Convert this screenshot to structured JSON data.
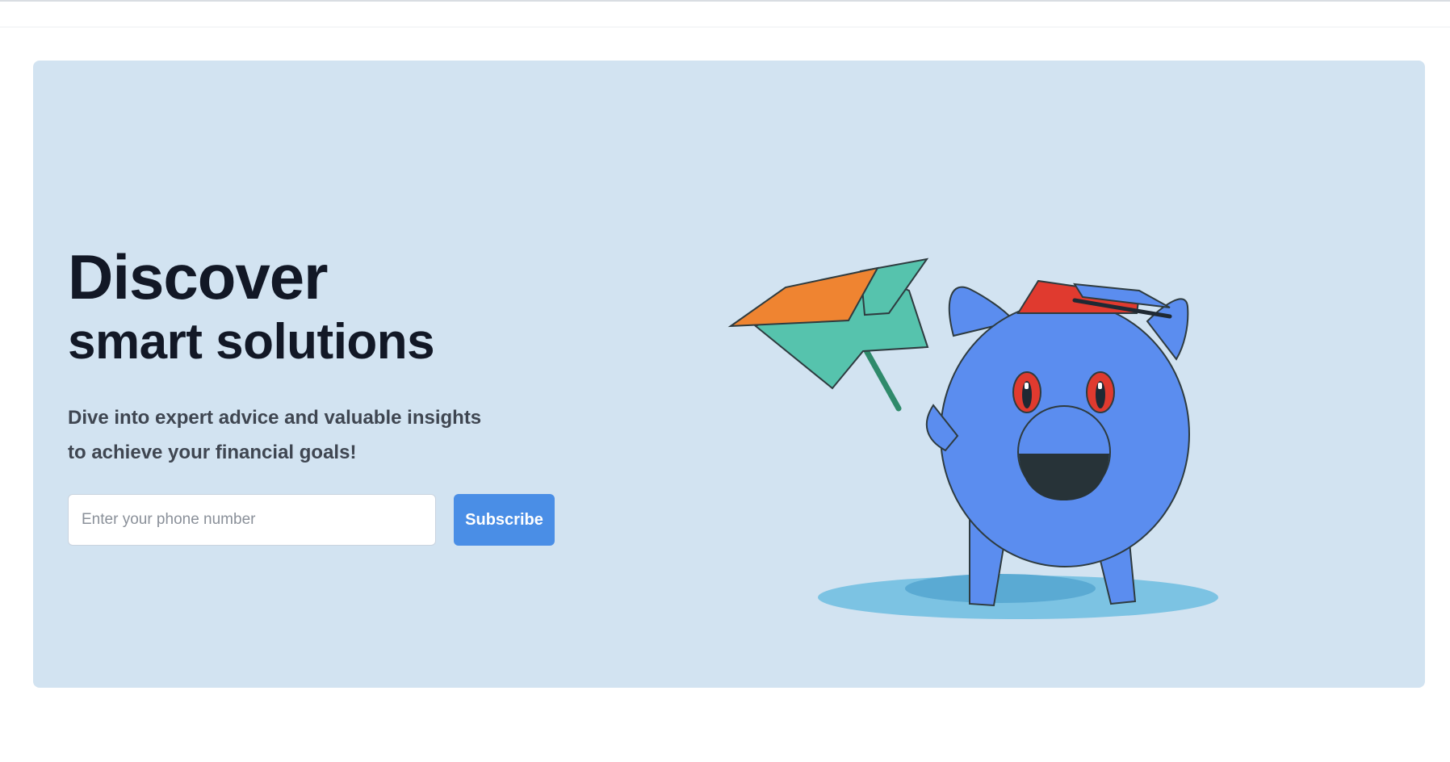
{
  "hero": {
    "title_line1": "Discover",
    "title_line2": "smart solutions",
    "subtitle_line1": "Dive into expert advice and valuable insights",
    "subtitle_line2": "to achieve your financial goals!",
    "phone_placeholder": "Enter your phone number",
    "subscribe_label": "Subscribe"
  },
  "colors": {
    "hero_background": "#d2e3f1",
    "accent_button": "#4a8ee6",
    "heading_text": "#121826",
    "body_text": "#3f4651",
    "pig_body": "#5b8def",
    "cap_red": "#e03a2f",
    "kite_orange": "#ef8431",
    "kite_teal": "#56c3ad",
    "shadow_blue": "#7cc3e3"
  },
  "illustration": {
    "icon": "piggy-bank-graduation-illustration"
  }
}
